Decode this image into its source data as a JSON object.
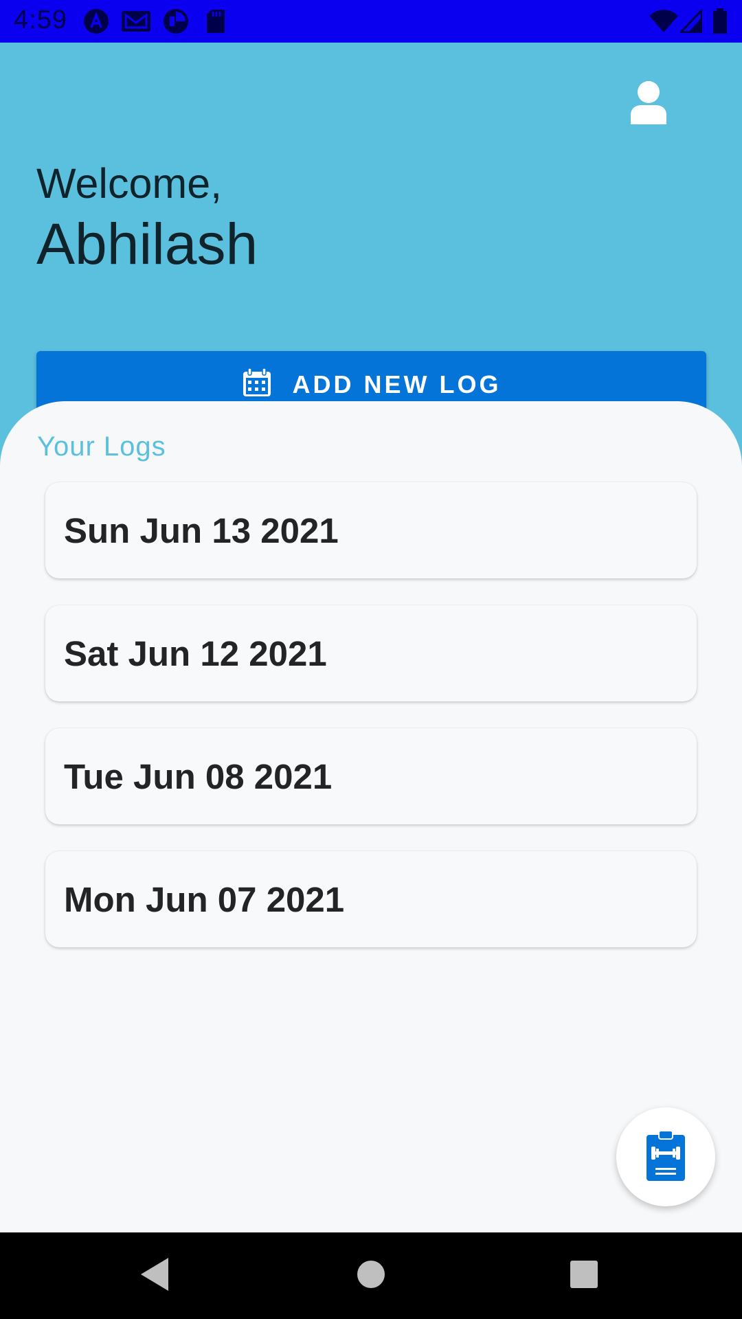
{
  "status_bar": {
    "time": "4:59",
    "left_icons": [
      "auto-a-icon",
      "mail-icon",
      "pie-icon",
      "sd-card-icon"
    ],
    "right_icons": [
      "wifi-icon",
      "signal-icon",
      "battery-icon"
    ],
    "color": "#0a00ef"
  },
  "header": {
    "welcome_label": "Welcome,",
    "user_name": "Abhilash",
    "profile_icon": "person-icon",
    "background_color": "#5bbfde"
  },
  "add_log_button": {
    "label": "ADD NEW LOG",
    "icon": "calendar-icon",
    "color": "#0474d8"
  },
  "logs": {
    "title": "Your Logs",
    "items": [
      {
        "date": "Sun Jun 13 2021"
      },
      {
        "date": "Sat Jun 12 2021"
      },
      {
        "date": "Tue Jun 08 2021"
      },
      {
        "date": "Mon Jun 07 2021"
      }
    ]
  },
  "fab": {
    "icon": "clipboard-dumbbell-icon",
    "color": "#0474d8"
  },
  "nav_bar": {
    "buttons": [
      "back-icon",
      "home-icon",
      "recents-icon"
    ]
  }
}
